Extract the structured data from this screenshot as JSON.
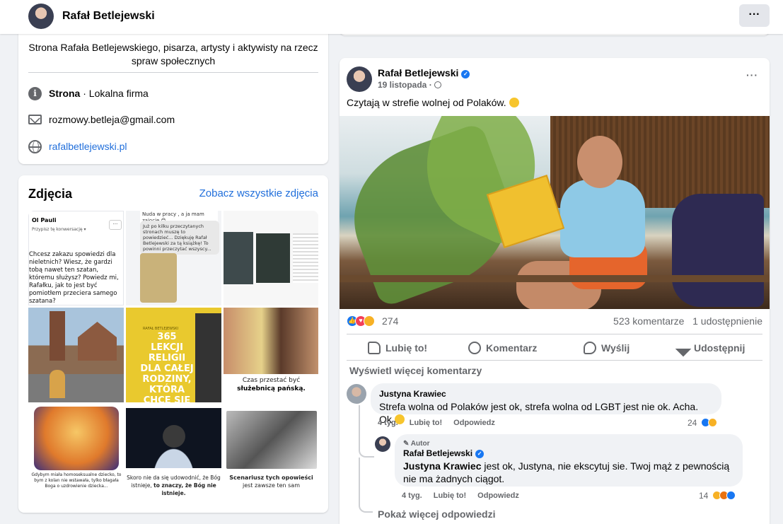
{
  "header": {
    "page_name": "Rafał Betlejewski",
    "more_label": "···"
  },
  "intro": {
    "bio": "Strona Rafała Betlejewskiego, pisarza, artysty i aktywisty na rzecz spraw społecznych",
    "category_bold": "Strona",
    "category_rest": " · Lokalna firma",
    "email": "rozmowy.betleja@gmail.com",
    "website": "rafalbetlejewski.pl"
  },
  "photos": {
    "title": "Zdjęcia",
    "see_all": "Zobacz wszystkie zdjęcia",
    "tiles": {
      "t1_name": "Ol Pauli",
      "t1_sub": "Przypisz tę konwersację ▾",
      "t1_text": "Chcesz zakazu spowiedzi dla nieletnich? Wiesz, że gardzi tobą nawet ten szatan, któremu służysz? Powiedz mi, Rafałku, jak to jest być pomiotłem przeciera samego szatana?",
      "t2_top": "Nuda w pracy , a ja mam zajęcie 😊",
      "t2_text": "Już po kilku przeczytanych stronach muszę to powiedzieć... Dziękuję Rafał Betlejewski za tą książkę! To powinni przeczytać wszyscy...",
      "t5_author": "RAFAŁ BETLEJEWSKI",
      "t5_book": "365 LEKCJI RELIGII DLA CAŁEJ RODZINY, KTÓRA CHCE SIĘ ROZWIĄZAĆ",
      "t6_caption_1": "Czas przestać być",
      "t6_caption_2": "służebnicą pańską.",
      "t7_caption": "Gdybym miała homoseksualne dziecko, to bym z kolan nie wstawała, tylko błagała Boga o uzdrowienie dziecka...",
      "t8_caption_1": "Skoro nie da się udowodnić, że Bóg istnieje, ",
      "t8_caption_2": "to znaczy, że Bóg nie istnieje.",
      "t9_caption_1": "Scenariusz tych opowieści",
      "t9_caption_2": " jest zawsze ten sam"
    }
  },
  "post": {
    "author": "Rafał Betlejewski",
    "date": "19 listopada",
    "privacy_icon": "globe-icon",
    "text": "Czytają w strefie wolnej od Polaków.",
    "reactions_count": "274",
    "comments_count": "523 komentarze",
    "shares_count": "1 udostępnienie",
    "actions": {
      "like": "Lubię to!",
      "comment": "Komentarz",
      "send": "Wyślij",
      "share": "Udostępnij"
    },
    "more_comments": "Wyświetl więcej komentarzy",
    "comments": [
      {
        "author": "Justyna Krawiec",
        "text": "Strefa wolna od Polaków jest ok, strefa wolna od LGBT jest nie ok. Acha. Ok",
        "time": "4 tyg.",
        "like": "Lubię to!",
        "reply": "Odpowiedz",
        "reactions": "24"
      }
    ],
    "reply": {
      "badge": "Autor",
      "author": "Rafał Betlejewski",
      "mention": "Justyna Krawiec",
      "text": " jest ok, Justyna, nie ekscytuj sie. Twoj mąż z pewnością nie ma żadnych ciągot.",
      "time": "4 tyg.",
      "like": "Lubię to!",
      "reply": "Odpowiedz",
      "reactions": "14"
    },
    "show_more_replies": "Pokaż więcej odpowiedzi"
  },
  "colors": {
    "link": "#216fdb",
    "verified": "#1877f2",
    "background": "#f0f2f5"
  }
}
